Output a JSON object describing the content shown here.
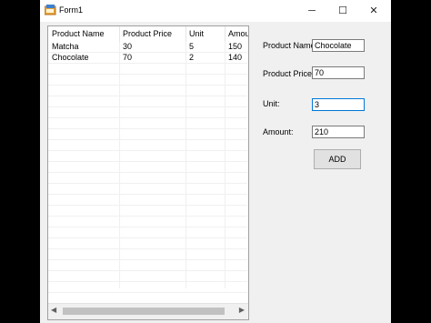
{
  "window": {
    "title": "Form1",
    "min_icon": "─",
    "max_icon": "☐",
    "close_icon": "✕"
  },
  "listview": {
    "columns": [
      "Product Name",
      "Product Price",
      "Unit",
      "Amoun"
    ],
    "rows": [
      [
        "Matcha",
        "30",
        "5",
        "150"
      ],
      [
        "Chocolate",
        "70",
        "2",
        "140"
      ]
    ],
    "scroll_left_icon": "◀",
    "scroll_right_icon": "▶"
  },
  "form": {
    "product_name_label": "Product Name:",
    "product_name_value": "Chocolate",
    "product_price_label": "Product Price:",
    "product_price_value": "70",
    "unit_label": "Unit:",
    "unit_value": "3",
    "amount_label": "Amount:",
    "amount_value": "210",
    "add_label": "ADD"
  }
}
